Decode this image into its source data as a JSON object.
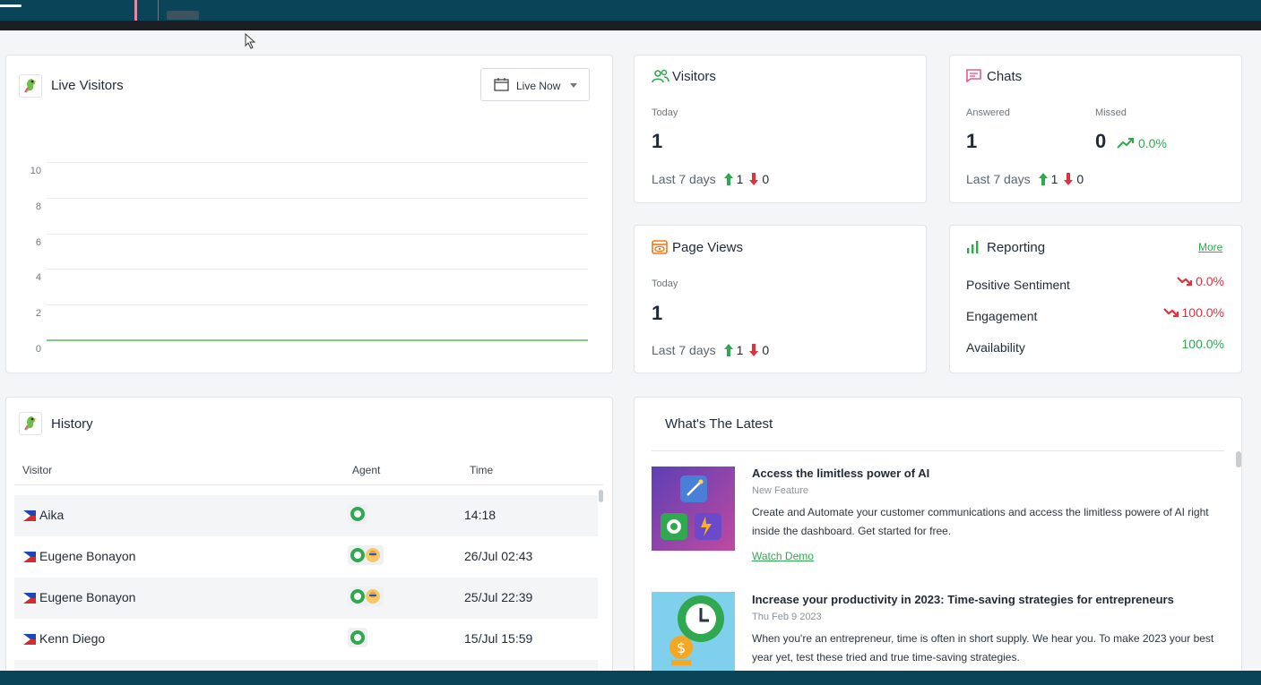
{
  "live_visitors": {
    "title": "Live Visitors",
    "filter_value": "Live Now"
  },
  "chart_data": {
    "type": "line",
    "title": "",
    "xlabel": "",
    "ylabel": "",
    "y_ticks": [
      "0",
      "2",
      "4",
      "6",
      "8",
      "10"
    ],
    "ylim": [
      0,
      10
    ],
    "series": [
      {
        "values": [
          0,
          0
        ]
      }
    ],
    "grid": true,
    "line_color": "#5cb85c"
  },
  "visitors": {
    "title": "Visitors",
    "today_label": "Today",
    "today_value": "1",
    "last7_label": "Last 7 days",
    "up": "1",
    "down": "0"
  },
  "chats": {
    "title": "Chats",
    "answered_label": "Answered",
    "answered_value": "1",
    "missed_label": "Missed",
    "missed_value": "0",
    "missed_trend": "0.0%",
    "last7_label": "Last 7 days",
    "up": "1",
    "down": "0"
  },
  "page_views": {
    "title": "Page Views",
    "today_label": "Today",
    "today_value": "1",
    "last7_label": "Last 7 days",
    "up": "1",
    "down": "0"
  },
  "reporting": {
    "title": "Reporting",
    "more_link": "More",
    "rows": [
      {
        "label": "Positive Sentiment",
        "value": "0.0%"
      },
      {
        "label": "Engagement",
        "value": "100.0%"
      },
      {
        "label": "Availability",
        "value": "100.0%"
      }
    ]
  },
  "history": {
    "title": "History",
    "columns": [
      "Visitor",
      "Agent",
      "Time"
    ],
    "rows": [
      {
        "visitor": "Aika",
        "time": "14:18"
      },
      {
        "visitor": "Eugene Bonayon",
        "time": "26/Jul 02:43"
      },
      {
        "visitor": "Eugene Bonayon",
        "time": "25/Jul 22:39"
      },
      {
        "visitor": "Kenn Diego",
        "time": "15/Jul 15:59"
      }
    ]
  },
  "latest": {
    "title": "What's The Latest",
    "items": [
      {
        "title": "Access the limitless power of AI",
        "tag": "New Feature",
        "body": "Create and Automate your customer communications and access the limitless powere of AI right inside the dashboard. Get started for free.",
        "link": "Watch Demo"
      },
      {
        "title": "Increase your productivity in 2023: Time-saving strategies for entrepreneurs",
        "tag": "Thu Feb 9 2023",
        "body": "When you're an entrepreneur, time is often in short supply. We hear you. To make 2023 your best year yet, test these tried and true time-saving strategies."
      }
    ]
  },
  "colors": {
    "topbar": "#0a4458",
    "accent_green": "#2fa84f",
    "accent_red": "#e0323e",
    "chats_icon": "#e85a8c",
    "pageviews_icon": "#f07a1a"
  }
}
